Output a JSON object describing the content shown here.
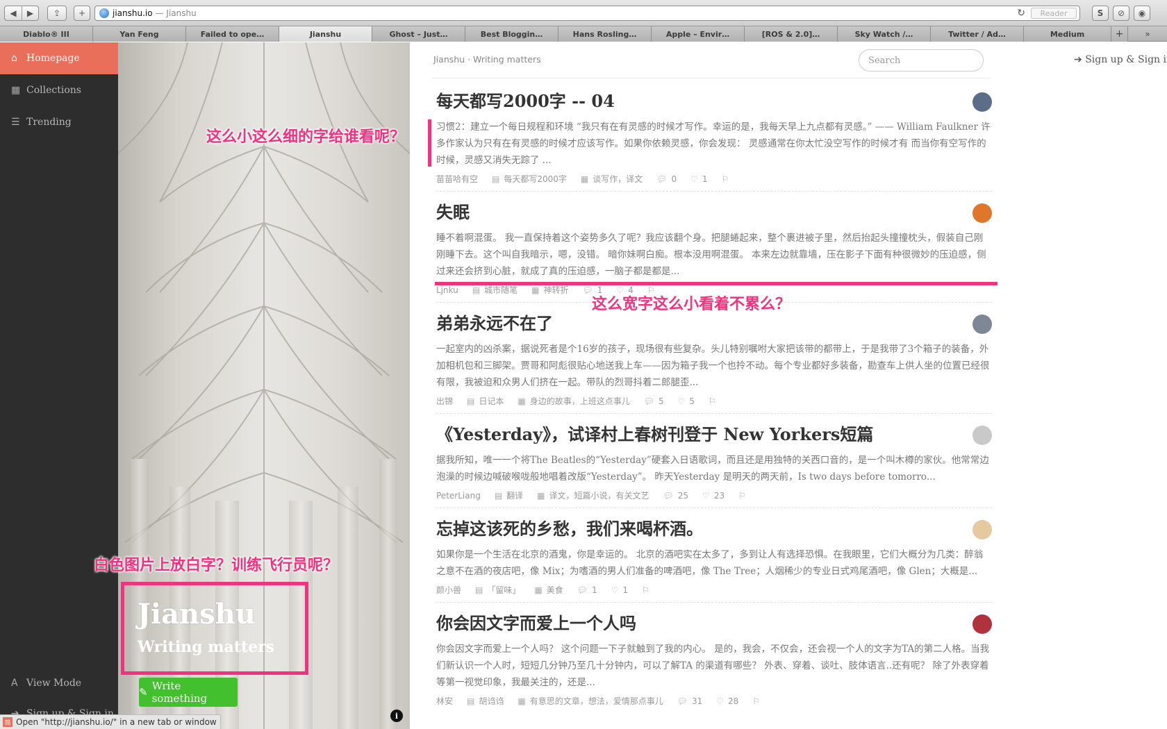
{
  "browser": {
    "url_host": "jianshu.io",
    "url_title": "— Jianshu",
    "reader_label": "Reader",
    "status_text": "Open \"http://jianshu.io/\" in a new tab or window",
    "tabs": [
      {
        "label": "Diablo® III"
      },
      {
        "label": "Yan Feng"
      },
      {
        "label": "Failed to ope…"
      },
      {
        "label": "Jianshu"
      },
      {
        "label": "Ghost – Just…"
      },
      {
        "label": "Best Bloggin…"
      },
      {
        "label": "Hans Rosling…"
      },
      {
        "label": "Apple – Envir…"
      },
      {
        "label": "[ROS & 2.0]…"
      },
      {
        "label": "Sky Watch /…"
      },
      {
        "label": "Twitter / Ad…"
      },
      {
        "label": "Medium"
      }
    ]
  },
  "sidebar": {
    "items": [
      {
        "label": "Homepage",
        "icon": "home-icon"
      },
      {
        "label": "Collections",
        "icon": "grid-icon"
      },
      {
        "label": "Trending",
        "icon": "list-icon"
      }
    ],
    "view_mode": "View Mode",
    "sign_in": "Sign up & Sign in"
  },
  "hero": {
    "title": "Jianshu",
    "subtitle": "Writing matters",
    "write_button": "Write something"
  },
  "topbar": {
    "brand": "Jianshu · Writing matters",
    "search_placeholder": "Search",
    "sign_in": "Sign up & Sign in"
  },
  "articles": [
    {
      "title": "每天都写2000字 -- 04",
      "abstract": "习惯2：建立一个每日规程和环境 “我只有在有灵感的时候才写作。幸运的是，我每天早上九点都有灵感。” —— William Faulkner 许多作家认为只有在有灵感的时候才应该写作。如果你依赖灵感，你会发现： 灵感通常在你太忙没空写作的时候才有 而当你有空写作的时候，灵感又消失无踪了 ...",
      "author": "苗苗哈有空",
      "notebook": "每天都写2000字",
      "collections": "谈写作，译文",
      "comments": "0",
      "likes": "1",
      "avatar_color": "#5a6e8a"
    },
    {
      "title": "失眠",
      "abstract": "睡不着啊混蛋。 我一直保持着这个姿势多久了呢？我应该翻个身。把腿蜷起来，整个裹进被子里，然后抬起头撞撞枕头，假装自己刚刚睡下去。这个叫自我暗示，嗯，没错。 暗你妹啊白痴。根本没用啊混蛋。 本来左边就靠墙，压在影子下面有种很微妙的压迫感，侧过来还会挤到心脏，就成了真的压迫感，一脑子都是都是...",
      "author": "Ljnku",
      "notebook": "城市随笔",
      "collections": "神转折",
      "comments": "1",
      "likes": "4",
      "avatar_color": "#e0762a"
    },
    {
      "title": "弟弟永远不在了",
      "abstract": "一起室内的凶杀案，据说死者是个16岁的孩子，现场很有些复杂。头儿特别嘱咐大家把该带的都带上，于是我带了3个箱子的装备，外加相机包和三脚架。贾哥和阿彪很贴心地送我上车——因为箱子我一个也拎不动。每个专业都好多装备，勘查车上供人坐的位置已经很有限，我被迫和众男人们挤在一起。带队的烈哥抖着二郎腿歪...",
      "author": "出锦",
      "notebook": "日记本",
      "collections": "身边的故事，上班这点事儿",
      "comments": "5",
      "likes": "5",
      "avatar_color": "#7d8796"
    },
    {
      "title": "《Yesterday》，试译村上春树刊登于 New Yorkers短篇",
      "abstract": "据我所知，唯一一个将The Beatles的“Yesterday”硬套入日语歌词，而且还是用独特的关西口音的，是一个叫木樽的家伙。他常常边泡澡的时候边喊破喉咙般地唱着改版“Yesterday”。 昨天Yesterday 是明天的两天前，Is two days before tomorro...",
      "author": "PeterLiang",
      "notebook": "翻译",
      "collections": "译文，短篇小说，有关文艺",
      "comments": "25",
      "likes": "23",
      "avatar_color": "#c9c9c9"
    },
    {
      "title": "忘掉这该死的乡愁，我们来喝杯酒。",
      "abstract": "如果你是一个生活在北京的酒鬼，你是幸运的。 北京的酒吧实在太多了，多到让人有选择恐惧。在我眼里，它们大概分为几类：醉翁之意不在酒的夜店吧，像 Mix；为嗜酒的男人们准备的啤酒吧，像 The Tree；人烟稀少的专业日式鸡尾酒吧，像 Glen；大概是...",
      "author": "颜小兽",
      "notebook": "「留味」",
      "collections": "美食",
      "comments": "1",
      "likes": "1",
      "avatar_color": "#e7c9a0"
    },
    {
      "title": "你会因文字而爱上一个人吗",
      "abstract": "你会因文字而爱上一个人吗？ 这个问题一下子就触到了我的内心。 是的，我会，不仅会，还会视一个人的文字为TA的第二人格。当我们新认识一个人时，短短几分钟乃至几十分钟内，可以了解TA 的渠道有哪些？ 外表、穿着、谈吐、肢体语言..还有呢？ 除了外表穿着等第一视觉印象，我最关注的，还是...",
      "author": "林安",
      "notebook": "胡诌诌",
      "collections": "有意思的文章，想法，爱情那点事儿",
      "comments": "31",
      "likes": "28",
      "avatar_color": "#b0323c"
    }
  ],
  "annotations": {
    "note1": "这么小这么细的字给谁看呢？",
    "note2": "这么宽字这么小看着不累么？",
    "note3": "白色图片上放白字？训练飞行员呢？",
    "color": "#f0337f"
  }
}
